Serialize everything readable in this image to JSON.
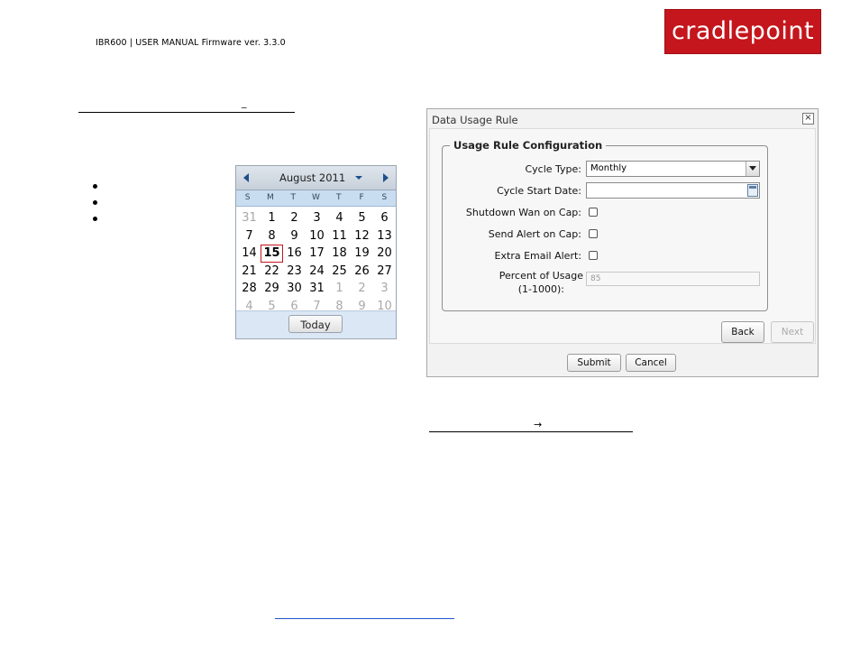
{
  "header": {
    "text": "IBR600 | USER MANUAL Firmware ver. 3.3.0",
    "logo": "cradlepoint"
  },
  "marks": {
    "underscore": "_",
    "arrow": "→"
  },
  "calendar": {
    "month_label": "August 2011",
    "weekdays": [
      "S",
      "M",
      "T",
      "W",
      "T",
      "F",
      "S"
    ],
    "weeks": [
      [
        "31",
        "1",
        "2",
        "3",
        "4",
        "5",
        "6"
      ],
      [
        "7",
        "8",
        "9",
        "10",
        "11",
        "12",
        "13"
      ],
      [
        "14",
        "15",
        "16",
        "17",
        "18",
        "19",
        "20"
      ],
      [
        "21",
        "22",
        "23",
        "24",
        "25",
        "26",
        "27"
      ],
      [
        "28",
        "29",
        "30",
        "31",
        "1",
        "2",
        "3"
      ],
      [
        "4",
        "5",
        "6",
        "7",
        "8",
        "9",
        "10"
      ]
    ],
    "selected_day": "15",
    "today_label": "Today"
  },
  "dialog": {
    "title": "Data Usage Rule",
    "close_glyph": "×",
    "legend": "Usage Rule Configuration",
    "cycle_type_label": "Cycle Type:",
    "cycle_type_value": "Monthly",
    "cycle_start_label": "Cycle Start Date:",
    "cycle_start_value": "",
    "shutdown_label": "Shutdown Wan on Cap:",
    "send_alert_label": "Send Alert on Cap:",
    "extra_email_label": "Extra Email Alert:",
    "percent_label_1": "Percent of Usage",
    "percent_label_2": "(1-1000):",
    "percent_value": "85",
    "back_label": "Back",
    "next_label": "Next",
    "submit_label": "Submit",
    "cancel_label": "Cancel"
  }
}
